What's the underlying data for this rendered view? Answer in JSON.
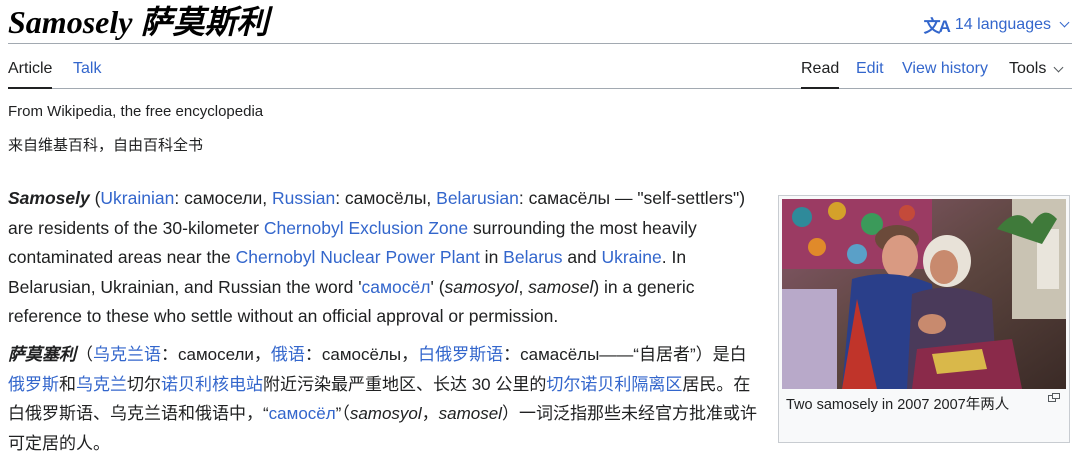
{
  "header": {
    "title": "Samosely  萨莫斯利",
    "languages_label": "14 languages",
    "languages_icon": "translate-icon"
  },
  "tabs": {
    "left": [
      {
        "label": "Article",
        "active": true
      },
      {
        "label": "Talk",
        "active": false
      }
    ],
    "right": [
      {
        "label": "Read",
        "active": true
      },
      {
        "label": "Edit",
        "active": false
      },
      {
        "label": "View history",
        "active": false
      },
      {
        "label": "Tools",
        "active": false
      }
    ]
  },
  "tagline": "From Wikipedia, the free encyclopedia",
  "tagline_zh": "来自维基百科，自由百科全书",
  "body_en": {
    "term": "Samosely",
    "open": " (",
    "l1": "Ukrainian",
    "t1": ": самосели, ",
    "l2": "Russian",
    "t2": ": самосёлы, ",
    "l3": "Belarusian",
    "t3": ": самасёлы — \"self-settlers\") are residents of the 30-kilometer ",
    "l4": "Chernobyl Exclusion Zone",
    "t4": " surrounding the most heavily contaminated areas near the ",
    "l5": "Chernobyl Nuclear Power Plant",
    "t5": " in ",
    "l6": "Belarus",
    "t6": " and ",
    "l7": "Ukraine",
    "t7": ". In Belarusian, Ukrainian, and Russian the word '",
    "l8": "самосёл",
    "t8": "' (",
    "i1": "samosyol",
    "t9": ", ",
    "i2": "samosel",
    "t10": ") in a generic reference to these who settle without an official approval or permission."
  },
  "body_zh": {
    "term": "萨莫塞利",
    "t0": "（",
    "l1": "乌克兰语",
    "t1": "：самосели，",
    "l2": "俄语",
    "t2": "：самосёлы，",
    "l3": "白俄罗斯语",
    "t3": "：самасёлы——“自居者”）是白",
    "l4": "俄罗斯",
    "t4": "和",
    "l5": "乌克兰",
    "t5": "切尔",
    "l6": "诺贝利核电站",
    "t6": "附近污染最严重地区、长达 30 公里的",
    "l7": "切尔诺贝利隔离区",
    "t7": "居民。在白俄罗斯语、乌克兰语和俄语中，“",
    "l8": "самосёл",
    "t8": "”（",
    "i1": "samosyol",
    "t9": "，",
    "i2": "samosel",
    "t10": "）一词泛指那些未经官方批准或许可定居的人。"
  },
  "infobox": {
    "caption": "Two samosely in 2007  2007年两人",
    "enlarge_icon": "enlarge-icon"
  },
  "colors": {
    "link": "#3366cc",
    "text": "#202122",
    "border": "#a2a9b1"
  }
}
